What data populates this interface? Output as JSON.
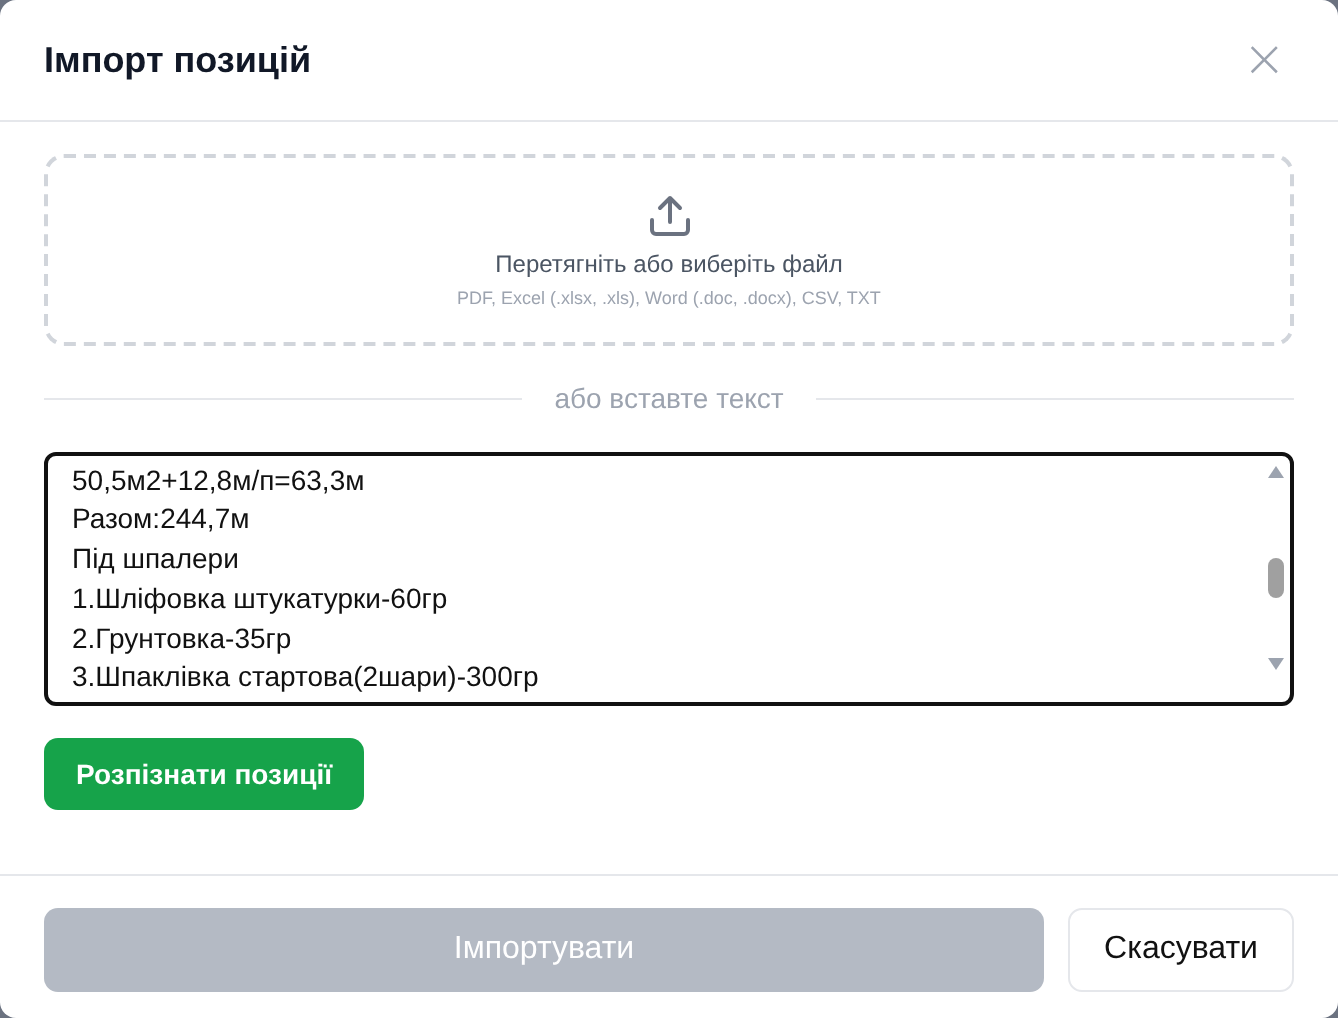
{
  "dialog": {
    "title": "Імпорт позицій",
    "close": "×"
  },
  "dropzone": {
    "label": "Перетягніть або виберіть файл",
    "formats": "PDF, Excel (.xlsx, .xls), Word (.doc, .docx), CSV, TXT"
  },
  "separator": "або вставте текст",
  "text_area": {
    "lines": [
      "50,5м2+12,8м/п=63,3м",
      "Разом:244,7м",
      "Під шпалери",
      "1.Шліфовка штукатурки-60гр",
      "2.Грунтовка-35гр",
      "3.Шпаклівка стартова(2шари)-300гр"
    ]
  },
  "recognize_button": {
    "label": "Розпізнати позиції",
    "disabled": false
  },
  "footer": {
    "buttons": [
      {
        "label": "Імпортувати",
        "kind": "primary",
        "disabled": true
      },
      {
        "label": "Скасувати",
        "kind": "secondary",
        "disabled": false
      }
    ]
  }
}
